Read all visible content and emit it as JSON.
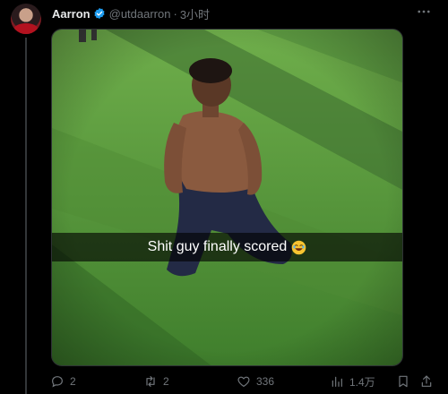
{
  "author": {
    "display_name": "Aarron",
    "handle": "@utdaarron",
    "separator": "·",
    "timestamp": "3小时",
    "verified": true,
    "verified_color": "#1d9bf0"
  },
  "media": {
    "caption": "Shit guy finally scored"
  },
  "actions": {
    "replies": "2",
    "retweets": "2",
    "likes": "336",
    "views": "1.4万"
  },
  "icons": {
    "reply": "reply-icon",
    "retweet": "retweet-icon",
    "like": "heart-icon",
    "views": "views-chart-icon",
    "bookmark": "bookmark-icon",
    "share": "share-icon",
    "more": "more-options-icon",
    "caption_emoji": "laughing-emoji-icon"
  },
  "colors": {
    "background": "#000000",
    "text_primary": "#e7e9ea",
    "text_secondary": "#71767b"
  }
}
